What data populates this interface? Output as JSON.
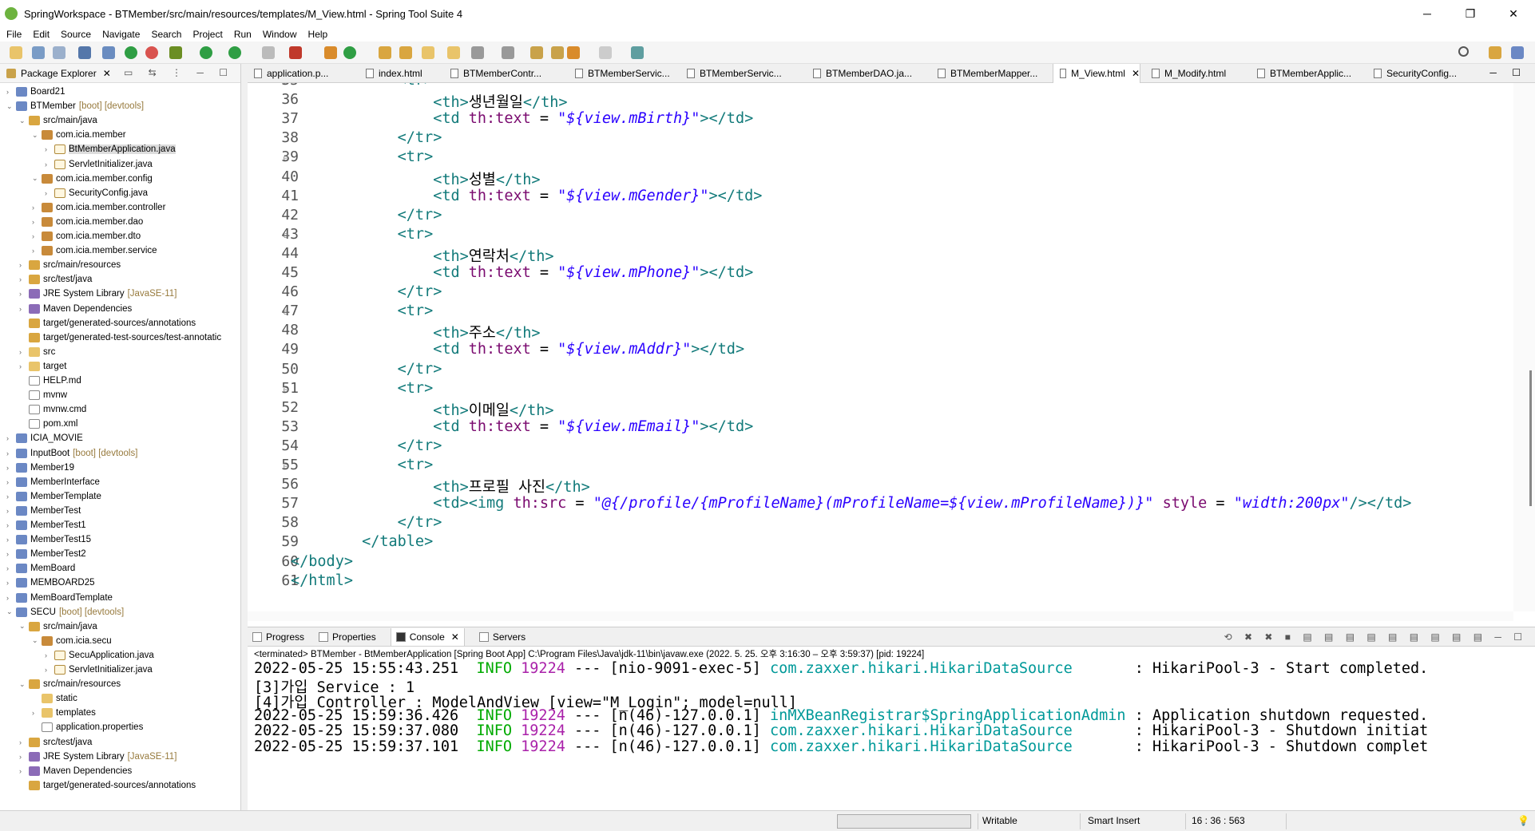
{
  "window": {
    "title": "SpringWorkspace - BTMember/src/main/resources/templates/M_View.html - Spring Tool Suite 4",
    "controls": [
      "─",
      "❐",
      "✕"
    ]
  },
  "menu": [
    "File",
    "Edit",
    "Source",
    "Navigate",
    "Search",
    "Project",
    "Run",
    "Window",
    "Help"
  ],
  "package_explorer": {
    "title": "Package Explorer",
    "items": [
      {
        "label": "Board21",
        "decor": "",
        "icon": "proj",
        "toggle": "›"
      },
      {
        "label": "BTMember",
        "decor": "[boot] [devtools]",
        "icon": "proj",
        "toggle": "⌄"
      },
      {
        "label": "src/main/java",
        "decor": "",
        "icon": "src",
        "toggle": "⌄"
      },
      {
        "label": "com.icia.member",
        "decor": "",
        "icon": "pkg",
        "toggle": "⌄"
      },
      {
        "label": "BtMemberApplication.java",
        "decor": "",
        "icon": "jfile",
        "toggle": "›"
      },
      {
        "label": "ServletInitializer.java",
        "decor": "",
        "icon": "jfile",
        "toggle": "›"
      },
      {
        "label": "com.icia.member.config",
        "decor": "",
        "icon": "pkg",
        "toggle": "⌄"
      },
      {
        "label": "SecurityConfig.java",
        "decor": "",
        "icon": "jfile",
        "toggle": "›"
      },
      {
        "label": "com.icia.member.controller",
        "decor": "",
        "icon": "pkg",
        "toggle": "›"
      },
      {
        "label": "com.icia.member.dao",
        "decor": "",
        "icon": "pkg",
        "toggle": "›"
      },
      {
        "label": "com.icia.member.dto",
        "decor": "",
        "icon": "pkg",
        "toggle": "›"
      },
      {
        "label": "com.icia.member.service",
        "decor": "",
        "icon": "pkg",
        "toggle": "›"
      },
      {
        "label": "src/main/resources",
        "decor": "",
        "icon": "src",
        "toggle": "›"
      },
      {
        "label": "src/test/java",
        "decor": "",
        "icon": "src",
        "toggle": "›"
      },
      {
        "label": "JRE System Library",
        "decor": "[JavaSE-11]",
        "icon": "lib",
        "toggle": "›"
      },
      {
        "label": "Maven Dependencies",
        "decor": "",
        "icon": "lib",
        "toggle": "›"
      },
      {
        "label": "target/generated-sources/annotations",
        "decor": "",
        "icon": "src",
        "toggle": ""
      },
      {
        "label": "target/generated-test-sources/test-annotatic",
        "decor": "",
        "icon": "src",
        "toggle": ""
      },
      {
        "label": "src",
        "decor": "",
        "icon": "folder",
        "toggle": "›"
      },
      {
        "label": "target",
        "decor": "",
        "icon": "folder",
        "toggle": "›"
      },
      {
        "label": "HELP.md",
        "decor": "",
        "icon": "file",
        "toggle": ""
      },
      {
        "label": "mvnw",
        "decor": "",
        "icon": "file",
        "toggle": ""
      },
      {
        "label": "mvnw.cmd",
        "decor": "",
        "icon": "file",
        "toggle": ""
      },
      {
        "label": "pom.xml",
        "decor": "",
        "icon": "file",
        "toggle": ""
      },
      {
        "label": "ICIA_MOVIE",
        "decor": "",
        "icon": "proj",
        "toggle": "›"
      },
      {
        "label": "InputBoot",
        "decor": "[boot] [devtools]",
        "icon": "proj",
        "toggle": "›"
      },
      {
        "label": "Member19",
        "decor": "",
        "icon": "proj",
        "toggle": "›"
      },
      {
        "label": "MemberInterface",
        "decor": "",
        "icon": "proj",
        "toggle": "›"
      },
      {
        "label": "MemberTemplate",
        "decor": "",
        "icon": "proj",
        "toggle": "›"
      },
      {
        "label": "MemberTest",
        "decor": "",
        "icon": "proj",
        "toggle": "›"
      },
      {
        "label": "MemberTest1",
        "decor": "",
        "icon": "proj",
        "toggle": "›"
      },
      {
        "label": "MemberTest15",
        "decor": "",
        "icon": "proj",
        "toggle": "›"
      },
      {
        "label": "MemberTest2",
        "decor": "",
        "icon": "proj",
        "toggle": "›"
      },
      {
        "label": "MemBoard",
        "decor": "",
        "icon": "proj",
        "toggle": "›"
      },
      {
        "label": "MEMBOARD25",
        "decor": "",
        "icon": "proj",
        "toggle": "›"
      },
      {
        "label": "MemBoardTemplate",
        "decor": "",
        "icon": "proj",
        "toggle": "›"
      },
      {
        "label": "SECU",
        "decor": "[boot] [devtools]",
        "icon": "proj",
        "toggle": "⌄"
      },
      {
        "label": "src/main/java",
        "decor": "",
        "icon": "src",
        "toggle": "⌄"
      },
      {
        "label": "com.icia.secu",
        "decor": "",
        "icon": "pkg",
        "toggle": "⌄"
      },
      {
        "label": "SecuApplication.java",
        "decor": "",
        "icon": "jfile",
        "toggle": "›"
      },
      {
        "label": "ServletInitializer.java",
        "decor": "",
        "icon": "jfile",
        "toggle": "›"
      },
      {
        "label": "src/main/resources",
        "decor": "",
        "icon": "src",
        "toggle": "⌄"
      },
      {
        "label": "static",
        "decor": "",
        "icon": "folder",
        "toggle": ""
      },
      {
        "label": "templates",
        "decor": "",
        "icon": "folder",
        "toggle": "›"
      },
      {
        "label": "application.properties",
        "decor": "",
        "icon": "file",
        "toggle": ""
      },
      {
        "label": "src/test/java",
        "decor": "",
        "icon": "src",
        "toggle": "›"
      },
      {
        "label": "JRE System Library",
        "decor": "[JavaSE-11]",
        "icon": "lib",
        "toggle": "›"
      },
      {
        "label": "Maven Dependencies",
        "decor": "",
        "icon": "lib",
        "toggle": "›"
      },
      {
        "label": "target/generated-sources/annotations",
        "decor": "",
        "icon": "src",
        "toggle": ""
      }
    ]
  },
  "editor_tabs": [
    "application.p...",
    "index.html",
    "BTMemberContr...",
    "BTMemberServic...",
    "BTMemberServic...",
    "BTMemberDAO.ja...",
    "BTMemberMapper...",
    "M_View.html",
    "M_Modify.html",
    "BTMemberApplic...",
    "SecurityConfig..."
  ],
  "active_tab": "M_View.html",
  "code_lines": [
    {
      "n": "35",
      "fold": true,
      "indent": 12,
      "parts": [
        [
          "tag",
          "<tr>"
        ]
      ]
    },
    {
      "n": "36",
      "fold": false,
      "indent": 16,
      "parts": [
        [
          "tag",
          "<th>"
        ],
        [
          "text",
          "생년월일"
        ],
        [
          "tag",
          "</th>"
        ]
      ]
    },
    {
      "n": "37",
      "fold": false,
      "indent": 16,
      "parts": [
        [
          "tag",
          "<td "
        ],
        [
          "attr",
          "th:text"
        ],
        [
          "text",
          " = "
        ],
        [
          "str",
          "\"${view.mBirth}\""
        ],
        [
          "tag",
          "></td>"
        ]
      ]
    },
    {
      "n": "38",
      "fold": false,
      "indent": 12,
      "parts": [
        [
          "tag",
          "</tr>"
        ]
      ]
    },
    {
      "n": "39",
      "fold": true,
      "indent": 12,
      "parts": [
        [
          "tag",
          "<tr>"
        ]
      ]
    },
    {
      "n": "40",
      "fold": false,
      "indent": 16,
      "parts": [
        [
          "tag",
          "<th>"
        ],
        [
          "text",
          "성별"
        ],
        [
          "tag",
          "</th>"
        ]
      ]
    },
    {
      "n": "41",
      "fold": false,
      "indent": 16,
      "parts": [
        [
          "tag",
          "<td "
        ],
        [
          "attr",
          "th:text"
        ],
        [
          "text",
          " = "
        ],
        [
          "str",
          "\"${view.mGender}\""
        ],
        [
          "tag",
          "></td>"
        ]
      ]
    },
    {
      "n": "42",
      "fold": false,
      "indent": 12,
      "parts": [
        [
          "tag",
          "</tr>"
        ]
      ]
    },
    {
      "n": "43",
      "fold": true,
      "indent": 12,
      "parts": [
        [
          "tag",
          "<tr>"
        ]
      ]
    },
    {
      "n": "44",
      "fold": false,
      "indent": 16,
      "parts": [
        [
          "tag",
          "<th>"
        ],
        [
          "text",
          "연락처"
        ],
        [
          "tag",
          "</th>"
        ]
      ]
    },
    {
      "n": "45",
      "fold": false,
      "indent": 16,
      "parts": [
        [
          "tag",
          "<td "
        ],
        [
          "attr",
          "th:text"
        ],
        [
          "text",
          " = "
        ],
        [
          "str",
          "\"${view.mPhone}\""
        ],
        [
          "tag",
          "></td>"
        ]
      ]
    },
    {
      "n": "46",
      "fold": false,
      "indent": 12,
      "parts": [
        [
          "tag",
          "</tr>"
        ]
      ]
    },
    {
      "n": "47",
      "fold": true,
      "indent": 12,
      "parts": [
        [
          "tag",
          "<tr>"
        ]
      ]
    },
    {
      "n": "48",
      "fold": false,
      "indent": 16,
      "parts": [
        [
          "tag",
          "<th>"
        ],
        [
          "text",
          "주소"
        ],
        [
          "tag",
          "</th>"
        ]
      ]
    },
    {
      "n": "49",
      "fold": false,
      "indent": 16,
      "parts": [
        [
          "tag",
          "<td "
        ],
        [
          "attr",
          "th:text"
        ],
        [
          "text",
          " = "
        ],
        [
          "str",
          "\"${view.mAddr}\""
        ],
        [
          "tag",
          "></td>"
        ]
      ]
    },
    {
      "n": "50",
      "fold": false,
      "indent": 12,
      "parts": [
        [
          "tag",
          "</tr>"
        ]
      ]
    },
    {
      "n": "51",
      "fold": true,
      "indent": 12,
      "parts": [
        [
          "tag",
          "<tr>"
        ]
      ]
    },
    {
      "n": "52",
      "fold": false,
      "indent": 16,
      "parts": [
        [
          "tag",
          "<th>"
        ],
        [
          "text",
          "이메일"
        ],
        [
          "tag",
          "</th>"
        ]
      ]
    },
    {
      "n": "53",
      "fold": false,
      "indent": 16,
      "parts": [
        [
          "tag",
          "<td "
        ],
        [
          "attr",
          "th:text"
        ],
        [
          "text",
          " = "
        ],
        [
          "str",
          "\"${view.mEmail}\""
        ],
        [
          "tag",
          "></td>"
        ]
      ]
    },
    {
      "n": "54",
      "fold": false,
      "indent": 12,
      "parts": [
        [
          "tag",
          "</tr>"
        ]
      ]
    },
    {
      "n": "55",
      "fold": true,
      "indent": 12,
      "parts": [
        [
          "tag",
          "<tr>"
        ]
      ]
    },
    {
      "n": "56",
      "fold": false,
      "indent": 16,
      "parts": [
        [
          "tag",
          "<th>"
        ],
        [
          "text",
          "프로필 사진"
        ],
        [
          "tag",
          "</th>"
        ]
      ]
    },
    {
      "n": "57",
      "fold": false,
      "indent": 16,
      "parts": [
        [
          "tag",
          "<td><img "
        ],
        [
          "attr",
          "th:src"
        ],
        [
          "text",
          " = "
        ],
        [
          "str",
          "\"@{/profile/{mProfileName}(mProfileName=${view.mProfileName})}\""
        ],
        [
          "text",
          " "
        ],
        [
          "attr",
          "style"
        ],
        [
          "text",
          " = "
        ],
        [
          "str",
          "\"width:200px\""
        ],
        [
          "tag",
          "/></td>"
        ]
      ]
    },
    {
      "n": "58",
      "fold": false,
      "indent": 12,
      "parts": [
        [
          "tag",
          "</tr>"
        ]
      ]
    },
    {
      "n": "59",
      "fold": false,
      "indent": 8,
      "parts": [
        [
          "tag",
          "</table>"
        ]
      ]
    },
    {
      "n": "60",
      "fold": false,
      "indent": 0,
      "parts": [
        [
          "tag",
          "</body>"
        ]
      ]
    },
    {
      "n": "61",
      "fold": false,
      "indent": 0,
      "parts": [
        [
          "tag",
          "</html>"
        ]
      ]
    }
  ],
  "bottom_tabs": [
    "Progress",
    "Properties",
    "Console",
    "Servers"
  ],
  "active_bottom_tab": "Console",
  "console": {
    "status": "<terminated> BTMember - BtMemberApplication [Spring Boot App] C:\\Program Files\\Java\\jdk-11\\bin\\javaw.exe  (2022. 5. 25. 오후 3:16:30 – 오후 3:59:37) [pid: 19224]",
    "lines": [
      [
        [
          "plain",
          "2022-05-25 15:55:43.251  "
        ],
        [
          "info",
          "INFO"
        ],
        [
          "plain",
          " "
        ],
        [
          "pid",
          "19224"
        ],
        [
          "plain",
          " --- [nio-9091-exec-5] "
        ],
        [
          "logger",
          "com.zaxxer.hikari.HikariDataSource      "
        ],
        [
          "plain",
          " : HikariPool-3 - Start completed."
        ]
      ],
      [
        [
          "plain",
          "[3]가입 Service : 1"
        ]
      ],
      [
        [
          "plain",
          "[4]가입 Controller : ModelAndView [view=\"M_Login\"; model=null]"
        ]
      ],
      [
        [
          "plain",
          "2022-05-25 15:59:36.426  "
        ],
        [
          "info",
          "INFO"
        ],
        [
          "plain",
          " "
        ],
        [
          "pid",
          "19224"
        ],
        [
          "plain",
          " --- [n(46)-127.0.0.1] "
        ],
        [
          "logger",
          "inMXBeanRegistrar$SpringApplicationAdmin"
        ],
        [
          "plain",
          " : Application shutdown requested."
        ]
      ],
      [
        [
          "plain",
          "2022-05-25 15:59:37.080  "
        ],
        [
          "info",
          "INFO"
        ],
        [
          "plain",
          " "
        ],
        [
          "pid",
          "19224"
        ],
        [
          "plain",
          " --- [n(46)-127.0.0.1] "
        ],
        [
          "logger",
          "com.zaxxer.hikari.HikariDataSource      "
        ],
        [
          "plain",
          " : HikariPool-3 - Shutdown initiat"
        ]
      ],
      [
        [
          "plain",
          "2022-05-25 15:59:37.101  "
        ],
        [
          "info",
          "INFO"
        ],
        [
          "plain",
          " "
        ],
        [
          "pid",
          "19224"
        ],
        [
          "plain",
          " --- [n(46)-127.0.0.1] "
        ],
        [
          "logger",
          "com.zaxxer.hikari.HikariDataSource      "
        ],
        [
          "plain",
          " : HikariPool-3 - Shutdown complet"
        ]
      ]
    ]
  },
  "statusbar": {
    "mode": "Writable",
    "insert": "Smart Insert",
    "position": "16 : 36 : 563"
  },
  "colors": {
    "tag": "#127a7a",
    "attr": "#7a0a6f",
    "string": "#2a00ff",
    "info": "#00aa00",
    "pid": "#aa22aa",
    "logger": "#009999"
  }
}
